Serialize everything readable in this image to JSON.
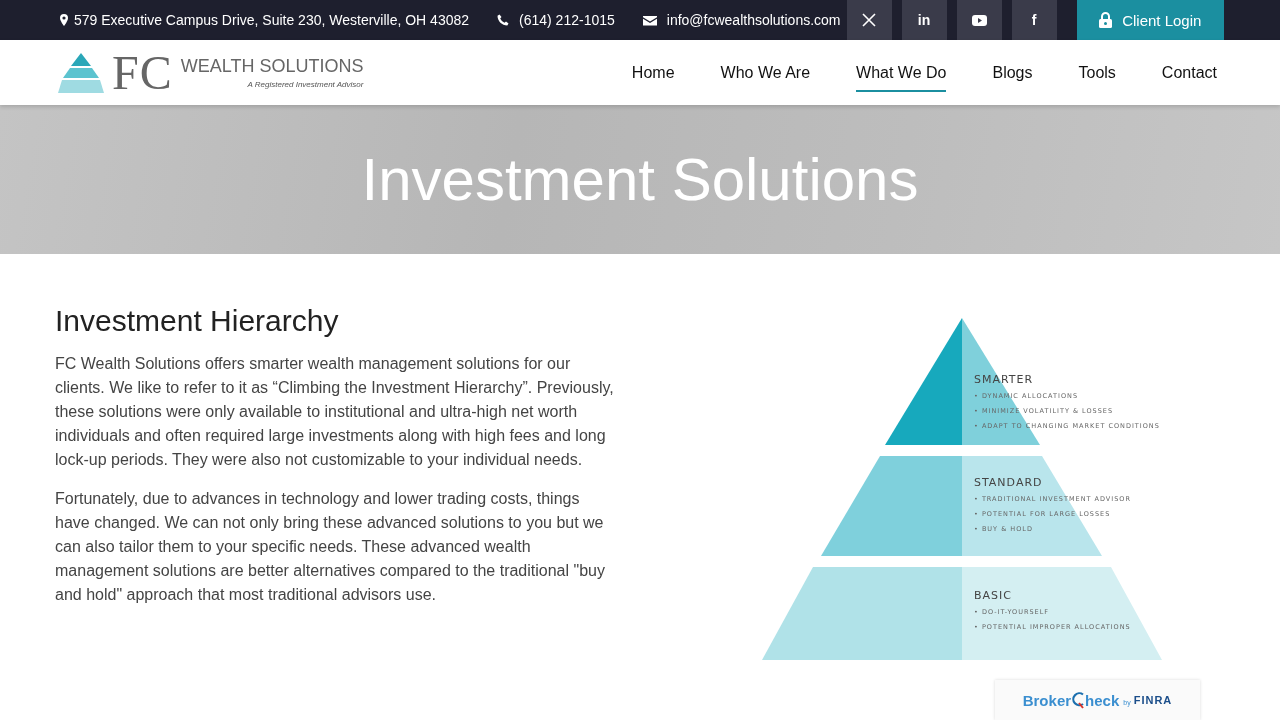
{
  "top_bar": {
    "address": "579 Executive Campus Drive, Suite 230, Westerville, OH 43082",
    "phone": "(614) 212-1015",
    "email": "info@fcwealthsolutions.com",
    "social": [
      {
        "kind": "x"
      },
      {
        "kind": "glyph",
        "label": "in"
      },
      {
        "kind": "play"
      },
      {
        "kind": "glyph",
        "label": "f"
      }
    ],
    "login": "Client Login"
  },
  "logo": {
    "initials": "FC",
    "name": "WEALTH SOLUTIONS",
    "tagline": "A Registered Investment Advisor"
  },
  "nav": [
    {
      "label": "Home",
      "selected": false
    },
    {
      "label": "Who We Are",
      "selected": false
    },
    {
      "label": "What We Do",
      "selected": true
    },
    {
      "label": "Blogs",
      "selected": false
    },
    {
      "label": "Tools",
      "selected": false
    },
    {
      "label": "Contact",
      "selected": false
    }
  ],
  "hero": {
    "title": "Investment Solutions"
  },
  "article": {
    "heading": "Investment Hierarchy",
    "paragraphs": [
      "FC Wealth Solutions offers smarter wealth management solutions for our clients. We like to refer to it as “Climbing the Investment Hierarchy”. Previously, these solutions were only available to institutional and ultra-high net worth individuals and often required large investments along with high fees and long lock-up periods. They were also not customizable to your individual needs.",
      "Fortunately, due to advances in technology and lower trading costs, things have changed. We can not only bring these advanced solutions to you but we can also tailor them to your specific needs. These advanced wealth management solutions are better alternatives compared to the traditional \"buy and hold\" approach that most traditional advisors use."
    ]
  },
  "pyramid": [
    {
      "title": "SMARTER",
      "color": "#17a9bd",
      "points": [
        "• DYNAMIC ALLOCATIONS",
        "• MINIMIZE VOLATILITY & LOSSES",
        "• ADAPT TO CHANGING MARKET CONDITIONS"
      ]
    },
    {
      "title": "STANDARD",
      "color": "#7fd0dc",
      "points": [
        "• TRADITIONAL INVESTMENT ADVISOR",
        "• POTENTIAL FOR LARGE LOSSES",
        "• BUY & HOLD"
      ]
    },
    {
      "title": "BASIC",
      "color": "#b0e2e8",
      "points": [
        "• DO-IT-YOURSELF",
        "• POTENTIAL IMPROPER ALLOCATIONS"
      ]
    }
  ],
  "brokercheck": {
    "broker": "Broker",
    "check": "heck",
    "by": "by",
    "org": "FINRA"
  }
}
